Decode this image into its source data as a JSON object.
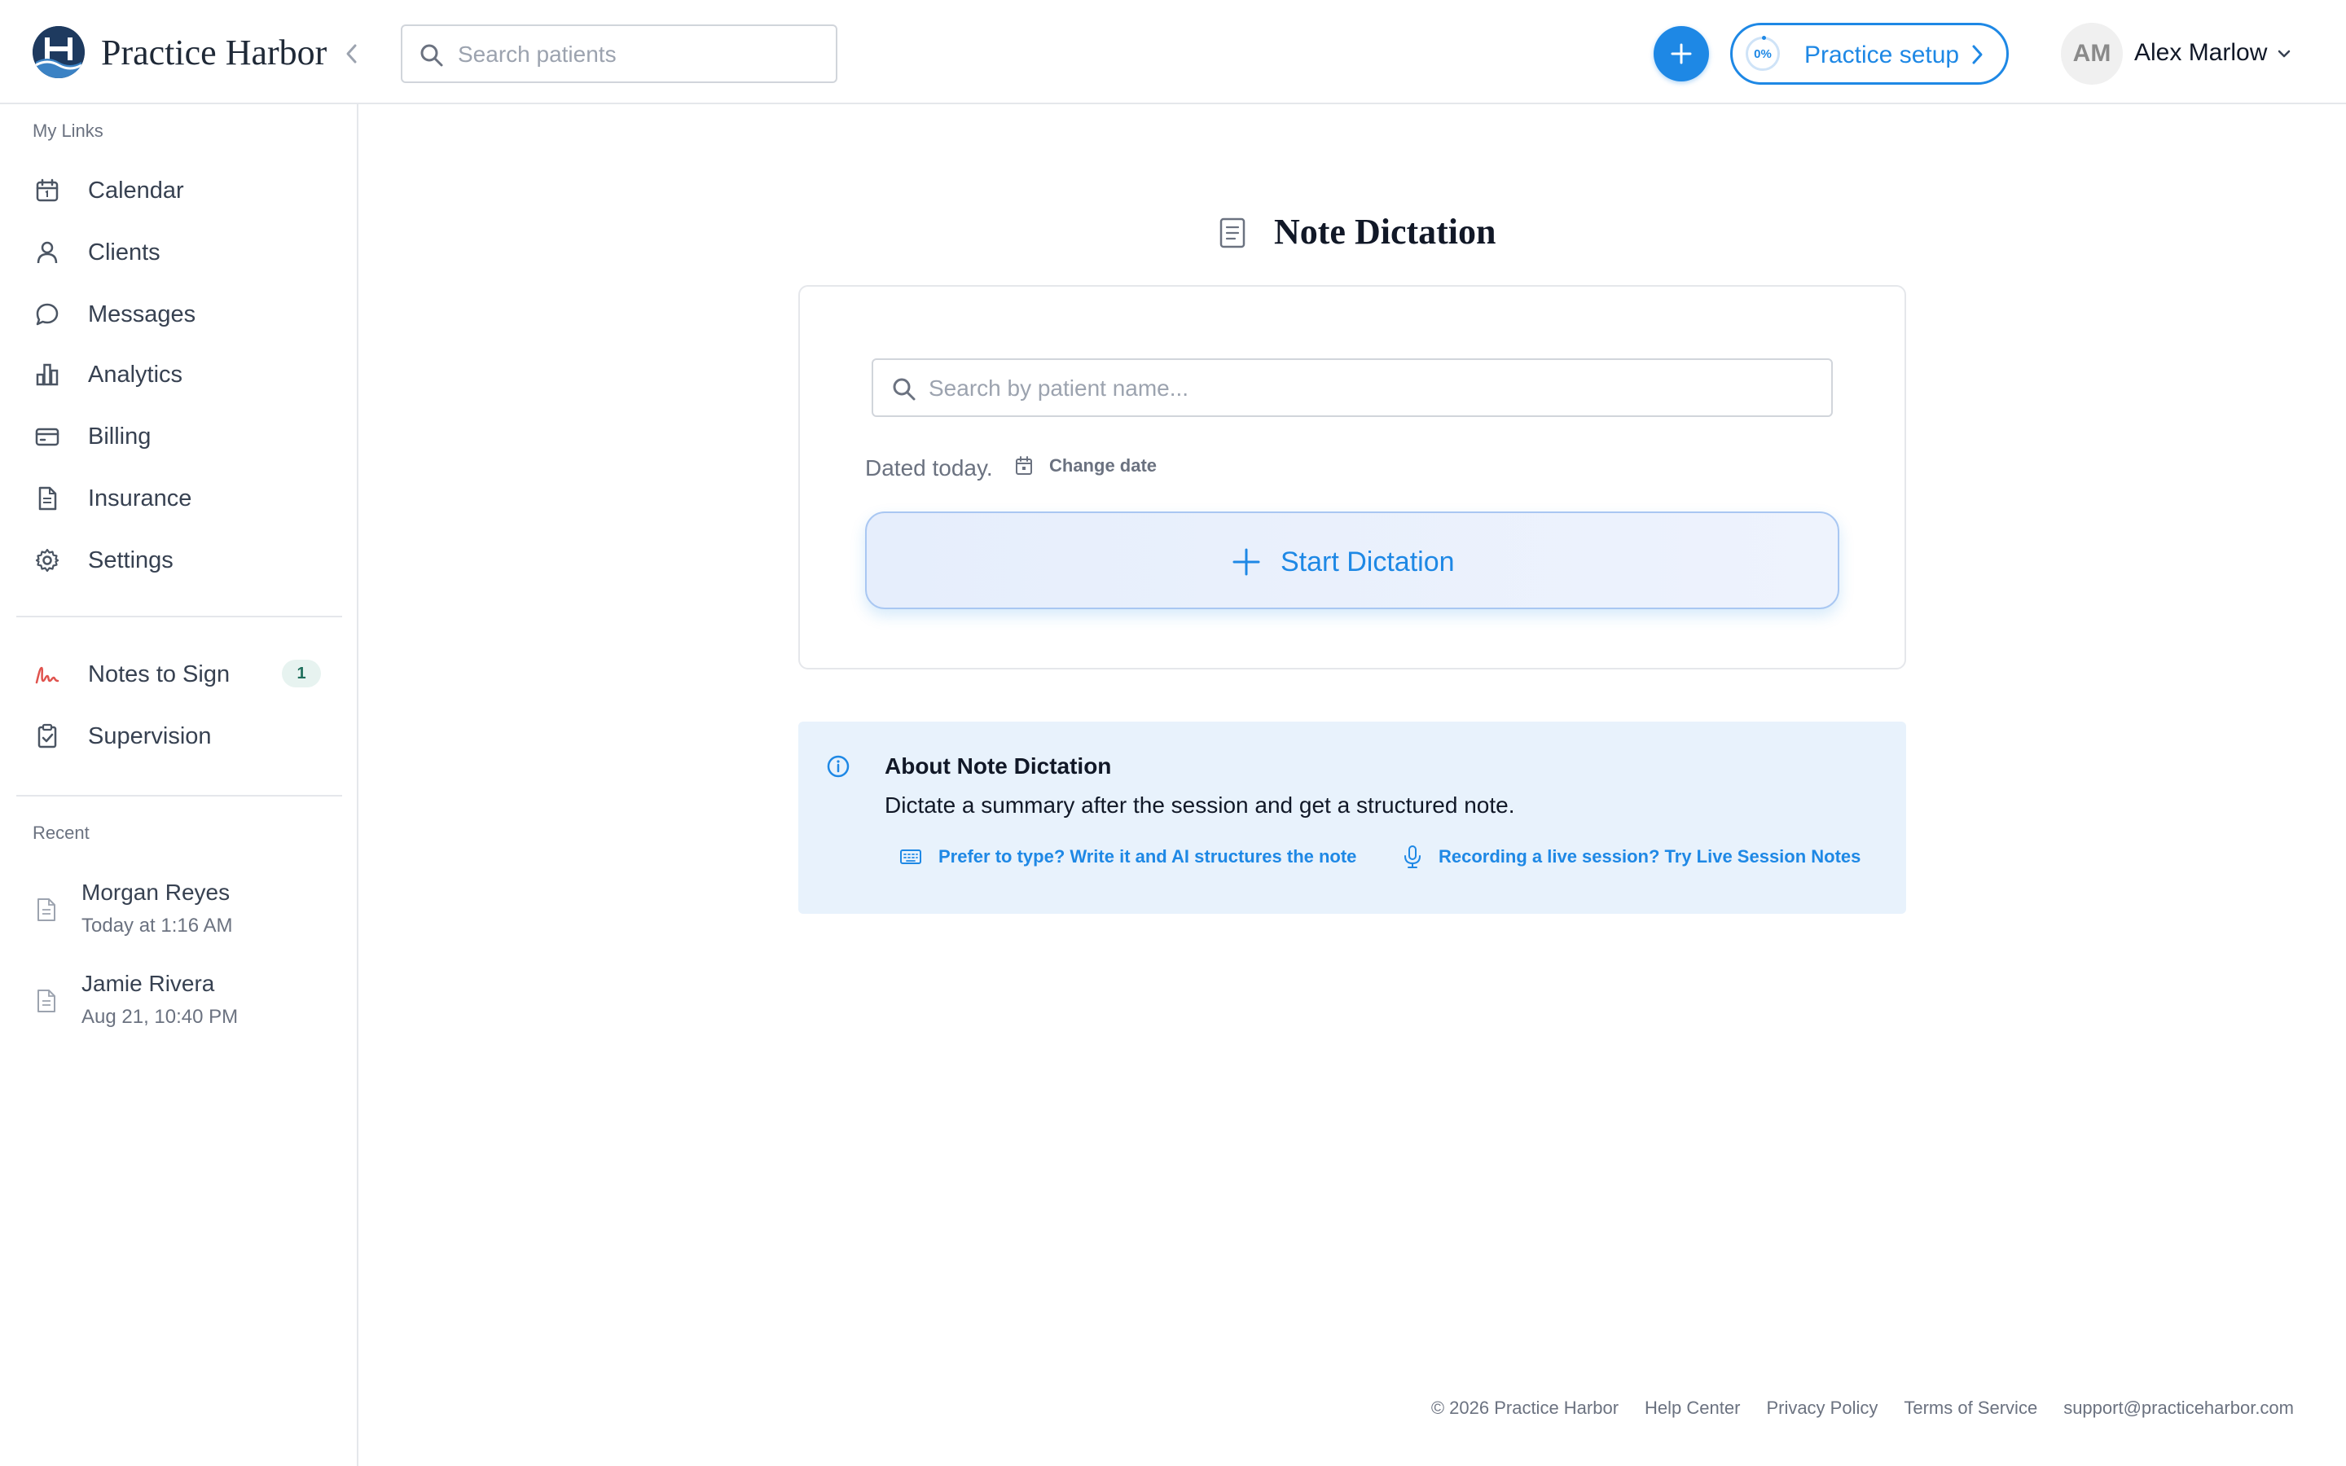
{
  "brand": {
    "name": "Practice Harbor"
  },
  "header": {
    "search_placeholder": "Search patients",
    "setup": {
      "label": "Practice setup",
      "progress_text": "0%",
      "progress": 0
    },
    "user": {
      "initials": "AM",
      "name": "Alex Marlow"
    }
  },
  "sidebar": {
    "section_my_links": "My Links",
    "items": [
      {
        "label": "Calendar",
        "icon": "calendar-icon"
      },
      {
        "label": "Clients",
        "icon": "user-icon"
      },
      {
        "label": "Messages",
        "icon": "chat-bubble-icon"
      },
      {
        "label": "Analytics",
        "icon": "bar-chart-icon"
      },
      {
        "label": "Billing",
        "icon": "credit-card-icon"
      },
      {
        "label": "Insurance",
        "icon": "document-icon"
      },
      {
        "label": "Settings",
        "icon": "gear-icon"
      }
    ],
    "secondary": [
      {
        "label": "Notes to Sign",
        "icon": "signature-icon",
        "badge": "1"
      },
      {
        "label": "Supervision",
        "icon": "clipboard-check-icon"
      }
    ],
    "section_recent": "Recent",
    "recent": [
      {
        "name": "Morgan Reyes",
        "time": "Today at 1:16 AM"
      },
      {
        "name": "Jamie Rivera",
        "time": "Aug 21, 10:40 PM"
      }
    ]
  },
  "main": {
    "title": "Note Dictation",
    "patient_search_placeholder": "Search by patient name...",
    "dated_text": "Dated today.",
    "change_date_label": "Change date",
    "start_button_label": "Start Dictation",
    "info": {
      "title": "About Note Dictation",
      "description": "Dictate a summary after the session and get a structured note.",
      "link_type": "Prefer to type? Write it and AI structures the note",
      "link_live": "Recording a live session? Try Live Session Notes"
    }
  },
  "footer": {
    "copyright": "© 2026 Practice Harbor",
    "links": [
      "Help Center",
      "Privacy Policy",
      "Terms of Service",
      "support@practiceharbor.com"
    ]
  },
  "colors": {
    "accent": "#1e88e5",
    "brand_dark": "#1e3a5f",
    "info_bg": "#e8f2fc",
    "signature": "#e0534e"
  }
}
